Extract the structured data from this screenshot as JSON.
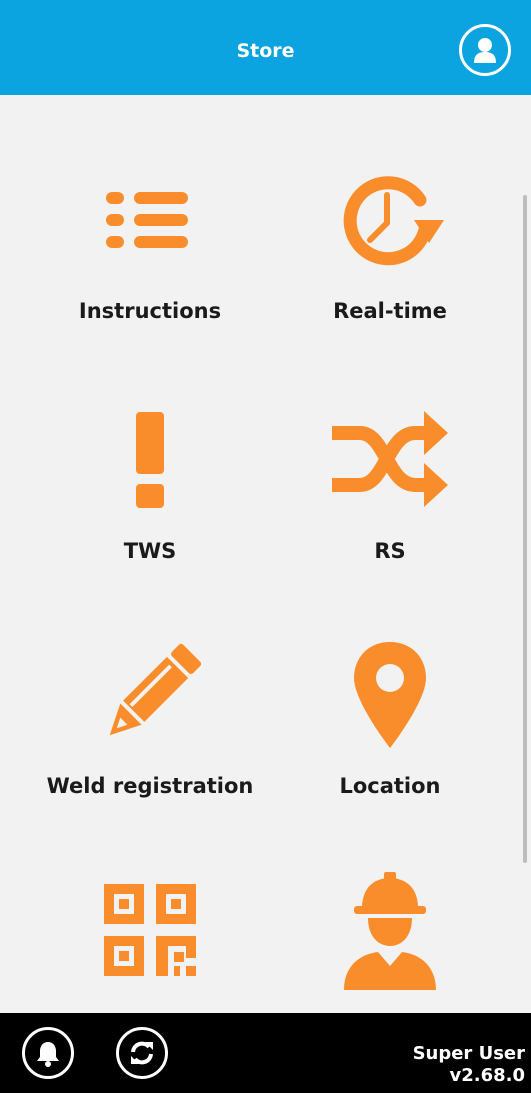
{
  "header": {
    "title": "Store",
    "user_icon": "user-icon"
  },
  "colors": {
    "header_bg": "#0ba3e0",
    "icon_orange": "#f98d2c",
    "footer_bg": "#000000"
  },
  "tiles": [
    {
      "label": "Instructions",
      "icon": "list-icon"
    },
    {
      "label": "Real-time",
      "icon": "history-icon"
    },
    {
      "label": "TWS",
      "icon": "exclamation-icon"
    },
    {
      "label": "RS",
      "icon": "shuffle-icon"
    },
    {
      "label": "Weld registration",
      "icon": "pencil-icon"
    },
    {
      "label": "Location",
      "icon": "map-marker-icon"
    },
    {
      "label": "",
      "icon": "qr-code-icon"
    },
    {
      "label": "",
      "icon": "worker-icon"
    }
  ],
  "footer": {
    "user_name": "Super User",
    "version": "v2.68.0",
    "bell_icon": "bell-icon",
    "sync_icon": "sync-icon"
  }
}
